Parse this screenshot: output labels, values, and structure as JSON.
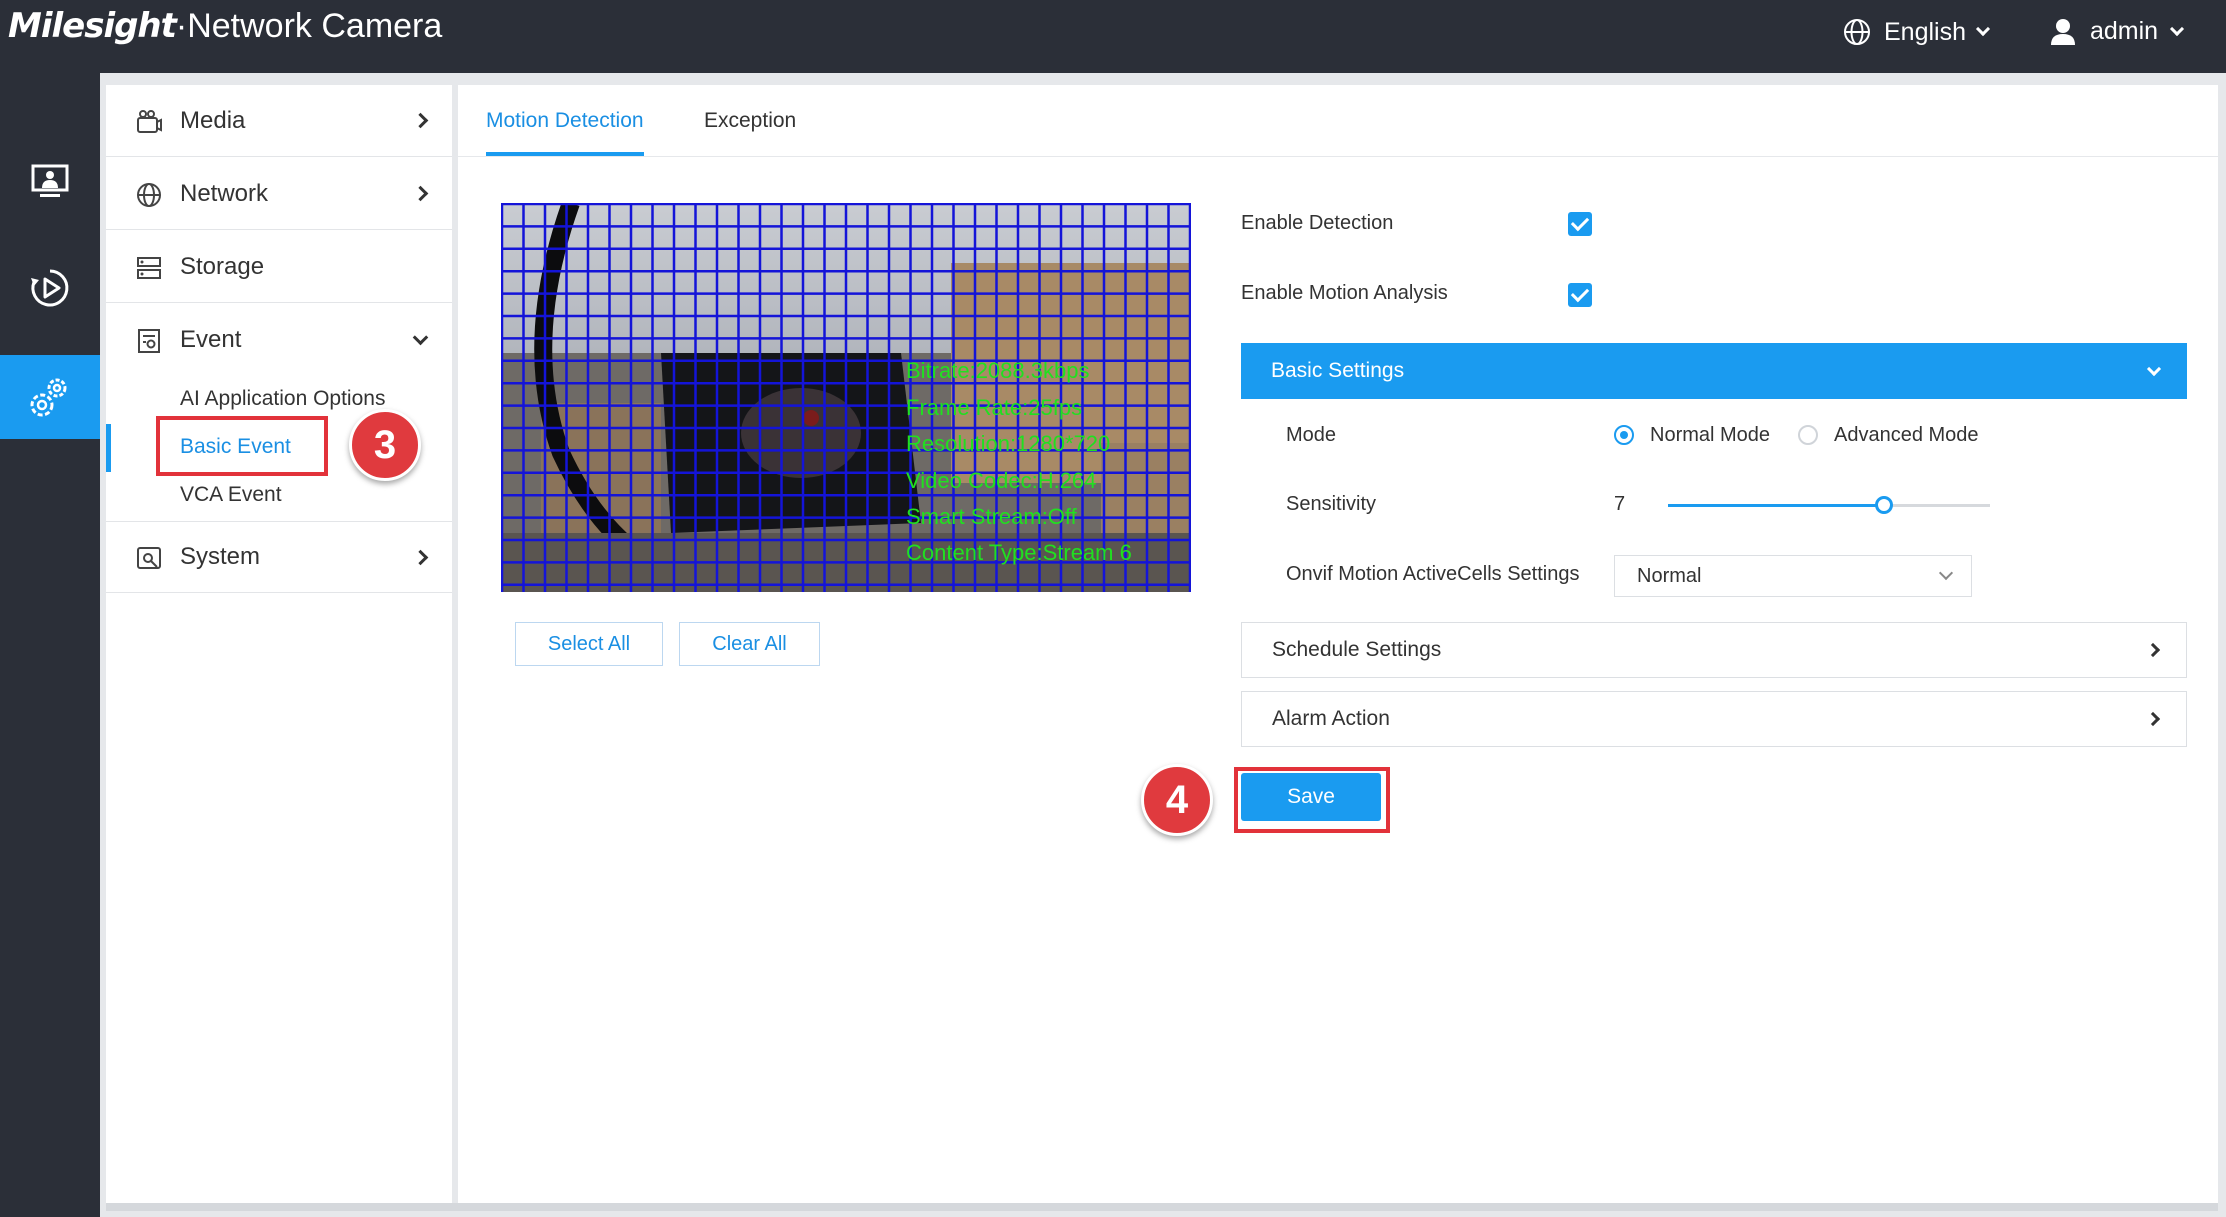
{
  "header": {
    "brand": "Milesight",
    "product": "·Network Camera",
    "language": "English",
    "user": "admin"
  },
  "rail": [
    {
      "icon": "monitor-icon",
      "label": "live-view"
    },
    {
      "icon": "playback-icon",
      "label": "playback"
    },
    {
      "icon": "settings-icon",
      "label": "settings",
      "active": true
    }
  ],
  "sidebar": {
    "media": "Media",
    "network": "Network",
    "storage": "Storage",
    "event": "Event",
    "event_sub": [
      "AI Application Options",
      "Basic Event",
      "VCA Event"
    ],
    "system": "System"
  },
  "annotations": {
    "step3": "3",
    "step4": "4"
  },
  "tabs": {
    "motion": "Motion Detection",
    "exception": "Exception"
  },
  "preview": {
    "overlay": [
      "Bitrate:2088.3kbps",
      "Frame Rate:25fps",
      "Resolution:1280*720",
      "Video Codec:H.264",
      "Smart Stream:Off",
      "Content Type:Stream 6"
    ],
    "select_all": "Select All",
    "clear_all": "Clear All"
  },
  "form": {
    "enable_detection": "Enable Detection",
    "enable_motion_analysis": "Enable Motion Analysis",
    "basic_settings": "Basic Settings",
    "mode_label": "Mode",
    "mode_normal": "Normal Mode",
    "mode_advanced": "Advanced Mode",
    "sensitivity_label": "Sensitivity",
    "sensitivity_value": "7",
    "sensitivity_fraction": 0.67,
    "onvif_label": "Onvif Motion ActiveCells Settings",
    "onvif_value": "Normal",
    "schedule": "Schedule Settings",
    "alarm": "Alarm Action",
    "save": "Save"
  },
  "colors": {
    "accent": "#1a9bf0",
    "header": "#2b2f38",
    "annotation": "#e2323a"
  }
}
